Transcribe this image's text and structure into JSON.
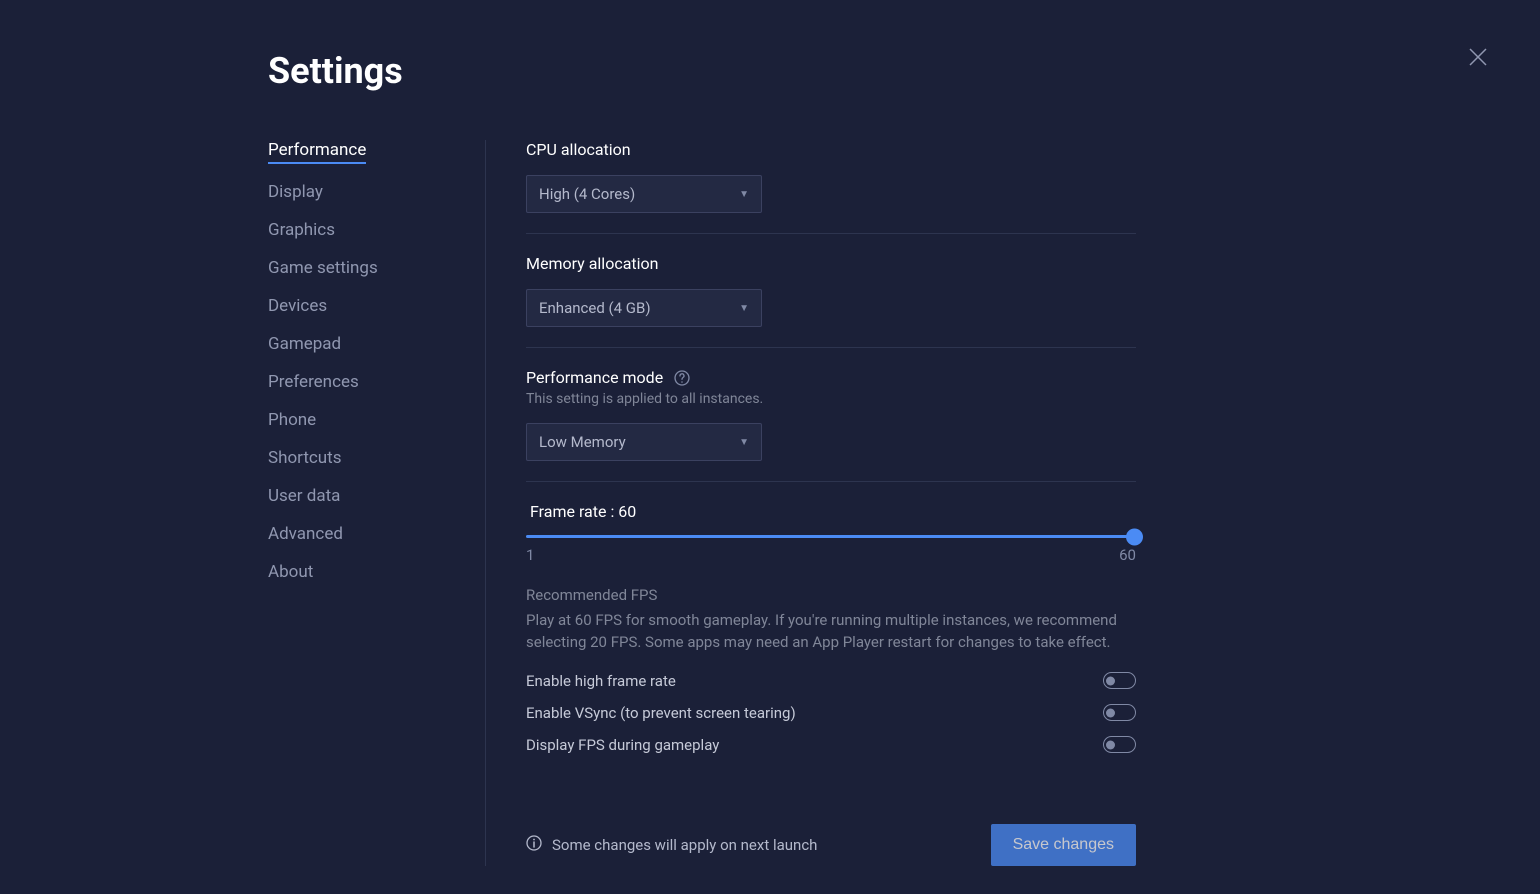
{
  "header": {
    "title": "Settings"
  },
  "sidebar": {
    "items": [
      {
        "label": "Performance",
        "active": true
      },
      {
        "label": "Display",
        "active": false
      },
      {
        "label": "Graphics",
        "active": false
      },
      {
        "label": "Game settings",
        "active": false
      },
      {
        "label": "Devices",
        "active": false
      },
      {
        "label": "Gamepad",
        "active": false
      },
      {
        "label": "Preferences",
        "active": false
      },
      {
        "label": "Phone",
        "active": false
      },
      {
        "label": "Shortcuts",
        "active": false
      },
      {
        "label": "User data",
        "active": false
      },
      {
        "label": "Advanced",
        "active": false
      },
      {
        "label": "About",
        "active": false
      }
    ]
  },
  "main": {
    "cpu": {
      "label": "CPU allocation",
      "value": "High (4 Cores)"
    },
    "memory": {
      "label": "Memory allocation",
      "value": "Enhanced (4 GB)"
    },
    "performance_mode": {
      "label": "Performance mode",
      "sublabel": "This setting is applied to all instances.",
      "value": "Low Memory"
    },
    "frame_rate": {
      "label": "Frame rate : 60",
      "min": "1",
      "max": "60",
      "note_title": "Recommended FPS",
      "note_body": "Play at 60 FPS for smooth gameplay. If you're running multiple instances, we recommend selecting 20 FPS. Some apps may need an App Player restart for changes to take effect."
    },
    "toggles": {
      "high_frame_rate": "Enable high frame rate",
      "vsync": "Enable VSync (to prevent screen tearing)",
      "display_fps": "Display FPS during gameplay"
    }
  },
  "footer": {
    "note": "Some changes will apply on next launch",
    "save_label": "Save changes"
  }
}
